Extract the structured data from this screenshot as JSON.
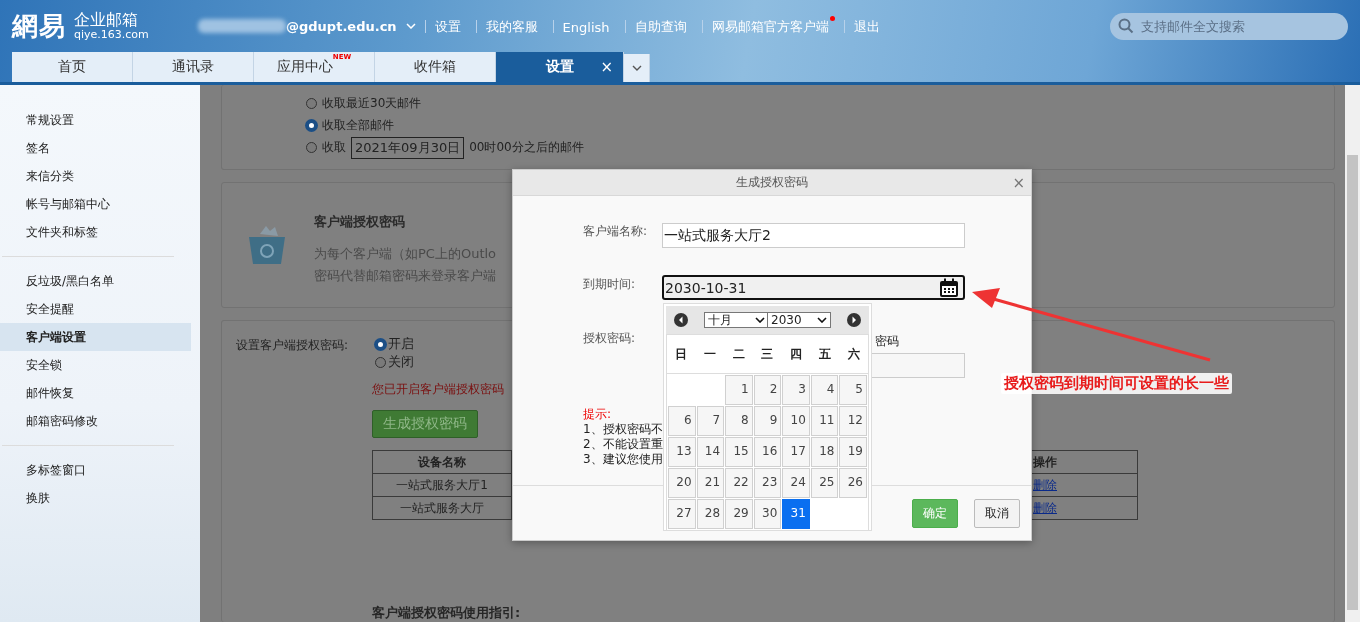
{
  "header": {
    "logo_mark": "網易",
    "logo_title": "企业邮箱",
    "logo_domain": "qiye.163.com",
    "account": "@gdupt.edu.cn",
    "links": [
      {
        "label": "设置",
        "dot": false
      },
      {
        "label": "我的客服",
        "dot": false
      },
      {
        "label": "English",
        "dot": false
      },
      {
        "label": "自助查询",
        "dot": false
      },
      {
        "label": "网易邮箱官方客户端",
        "dot": true
      },
      {
        "label": "退出",
        "dot": false
      }
    ],
    "search": {
      "placeholder": "支持邮件全文搜索"
    }
  },
  "tabs": [
    {
      "label": "首页",
      "selected": false
    },
    {
      "label": "通讯录",
      "selected": false
    },
    {
      "label": "应用中心",
      "selected": false,
      "badge": "NEW"
    },
    {
      "label": "收件箱",
      "selected": false
    },
    {
      "label": "设置",
      "selected": true,
      "close": "×"
    }
  ],
  "sidebar": {
    "groups": [
      [
        {
          "label": "常规设置",
          "selected": false
        },
        {
          "label": "签名",
          "selected": false
        },
        {
          "label": "来信分类",
          "selected": false
        },
        {
          "label": "帐号与邮箱中心",
          "selected": false
        },
        {
          "label": "文件夹和标签",
          "selected": false
        }
      ],
      [
        {
          "label": "反垃圾/黑白名单",
          "selected": false
        },
        {
          "label": "安全提醒",
          "selected": false
        },
        {
          "label": "客户端设置",
          "selected": true
        },
        {
          "label": "安全锁",
          "selected": false
        },
        {
          "label": "邮件恢复",
          "selected": false
        },
        {
          "label": "邮箱密码修改",
          "selected": false
        }
      ],
      [
        {
          "label": "多标签窗口",
          "selected": false
        },
        {
          "label": "换肤",
          "selected": false
        }
      ]
    ]
  },
  "fetch_options": [
    {
      "kind": "plain",
      "label": "收取最近30天邮件",
      "selected": false
    },
    {
      "kind": "plain",
      "label": "收取全部邮件",
      "selected": true
    },
    {
      "kind": "date",
      "label": "收取",
      "date": "2021年09月30日",
      "suffix": "00时00分之后的邮件",
      "selected": false
    }
  ],
  "auth_card": {
    "title": "客户端授权密码",
    "description": [
      "为每个客户端（如PC上的Outlo",
      "密码代替邮箱密码来登录客户端"
    ]
  },
  "auth_setting": {
    "label": "设置客户端授权密码:",
    "radios": [
      {
        "label": "开启",
        "selected": true
      },
      {
        "label": "关闭",
        "selected": false
      }
    ],
    "notice": "您已开启客户端授权密码",
    "button": "生成授权密码",
    "table": {
      "columns": [
        "设备名称",
        "操作"
      ],
      "rows": [
        {
          "name": "一站式服务大厅1",
          "action": "删除"
        },
        {
          "name": "一站式服务大厅",
          "action": "删除"
        }
      ]
    }
  },
  "guide_title": "客户端授权密码使用指引:",
  "dialog": {
    "title": "生成授权密码",
    "close": "×",
    "name": {
      "label": "客户端名称:",
      "value": "一站式服务大厅2"
    },
    "expiry": {
      "label": "到期时间:",
      "value": "2030-10-31"
    },
    "password": {
      "label": "授权密码:",
      "fragment": "密码"
    },
    "hint_title": "提示:",
    "hints": [
      "1、授权密码不",
      "2、不能设置重",
      "3、建议您使用"
    ],
    "confirm": "确定",
    "cancel": "取消"
  },
  "calendar": {
    "month": "十月",
    "year": "2030",
    "weekdays": [
      "日",
      "一",
      "二",
      "三",
      "四",
      "五",
      "六"
    ],
    "days": [
      {
        "kind": "blank"
      },
      {
        "kind": "blank"
      },
      {
        "label": "1",
        "selected": false
      },
      {
        "label": "2",
        "selected": false
      },
      {
        "label": "3",
        "selected": false
      },
      {
        "label": "4",
        "selected": false
      },
      {
        "label": "5",
        "selected": false
      },
      {
        "label": "6",
        "selected": false
      },
      {
        "label": "7",
        "selected": false
      },
      {
        "label": "8",
        "selected": false
      },
      {
        "label": "9",
        "selected": false
      },
      {
        "label": "10",
        "selected": false
      },
      {
        "label": "11",
        "selected": false
      },
      {
        "label": "12",
        "selected": false
      },
      {
        "label": "13",
        "selected": false
      },
      {
        "label": "14",
        "selected": false
      },
      {
        "label": "15",
        "selected": false
      },
      {
        "label": "16",
        "selected": false
      },
      {
        "label": "17",
        "selected": false
      },
      {
        "label": "18",
        "selected": false
      },
      {
        "label": "19",
        "selected": false
      },
      {
        "label": "20",
        "selected": false
      },
      {
        "label": "21",
        "selected": false
      },
      {
        "label": "22",
        "selected": false
      },
      {
        "label": "23",
        "selected": false
      },
      {
        "label": "24",
        "selected": false
      },
      {
        "label": "25",
        "selected": false
      },
      {
        "label": "26",
        "selected": false
      },
      {
        "label": "27",
        "selected": false
      },
      {
        "label": "28",
        "selected": false
      },
      {
        "label": "29",
        "selected": false
      },
      {
        "label": "30",
        "selected": false
      },
      {
        "label": "31",
        "selected": true
      }
    ]
  },
  "annotation": {
    "text": "授权密码到期时间可设置的长一些"
  }
}
